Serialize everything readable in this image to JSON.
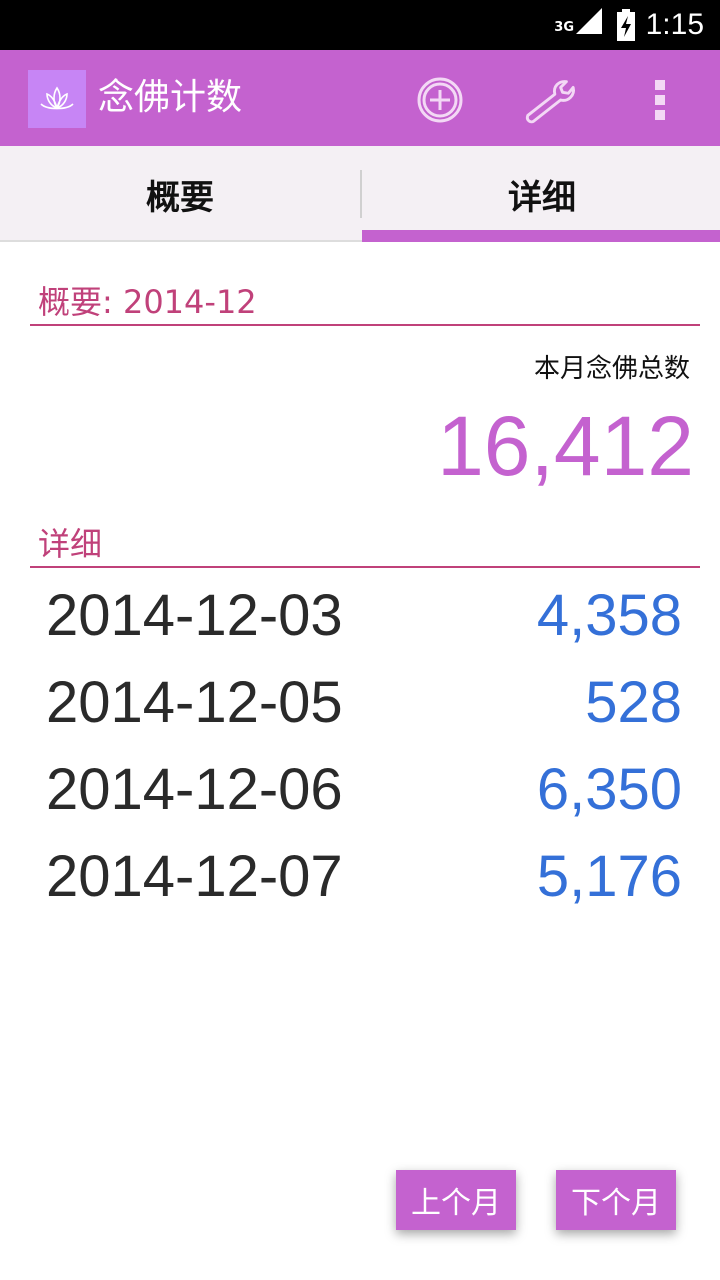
{
  "status_bar": {
    "network": "3G",
    "time": "1:15"
  },
  "app_bar": {
    "title": "念佛计数",
    "icons": [
      "lotus-logo-icon",
      "add-circle-icon",
      "wrench-icon",
      "overflow-menu-icon"
    ]
  },
  "tabs": [
    {
      "label": "概要",
      "selected": false
    },
    {
      "label": "详细",
      "selected": true
    }
  ],
  "summary": {
    "header": "概要: 2014-12",
    "total_label": "本月念佛总数",
    "total_value": "16,412"
  },
  "detail": {
    "header": "详细",
    "rows": [
      {
        "date": "2014-12-03",
        "count": "4,358"
      },
      {
        "date": "2014-12-05",
        "count": "528"
      },
      {
        "date": "2014-12-06",
        "count": "6,350"
      },
      {
        "date": "2014-12-07",
        "count": "5,176"
      }
    ]
  },
  "nav": {
    "prev_label": "上个月",
    "next_label": "下个月"
  },
  "colors": {
    "accent": "#c462cf",
    "header_text": "#c0417a",
    "count_text": "#3470d8"
  }
}
